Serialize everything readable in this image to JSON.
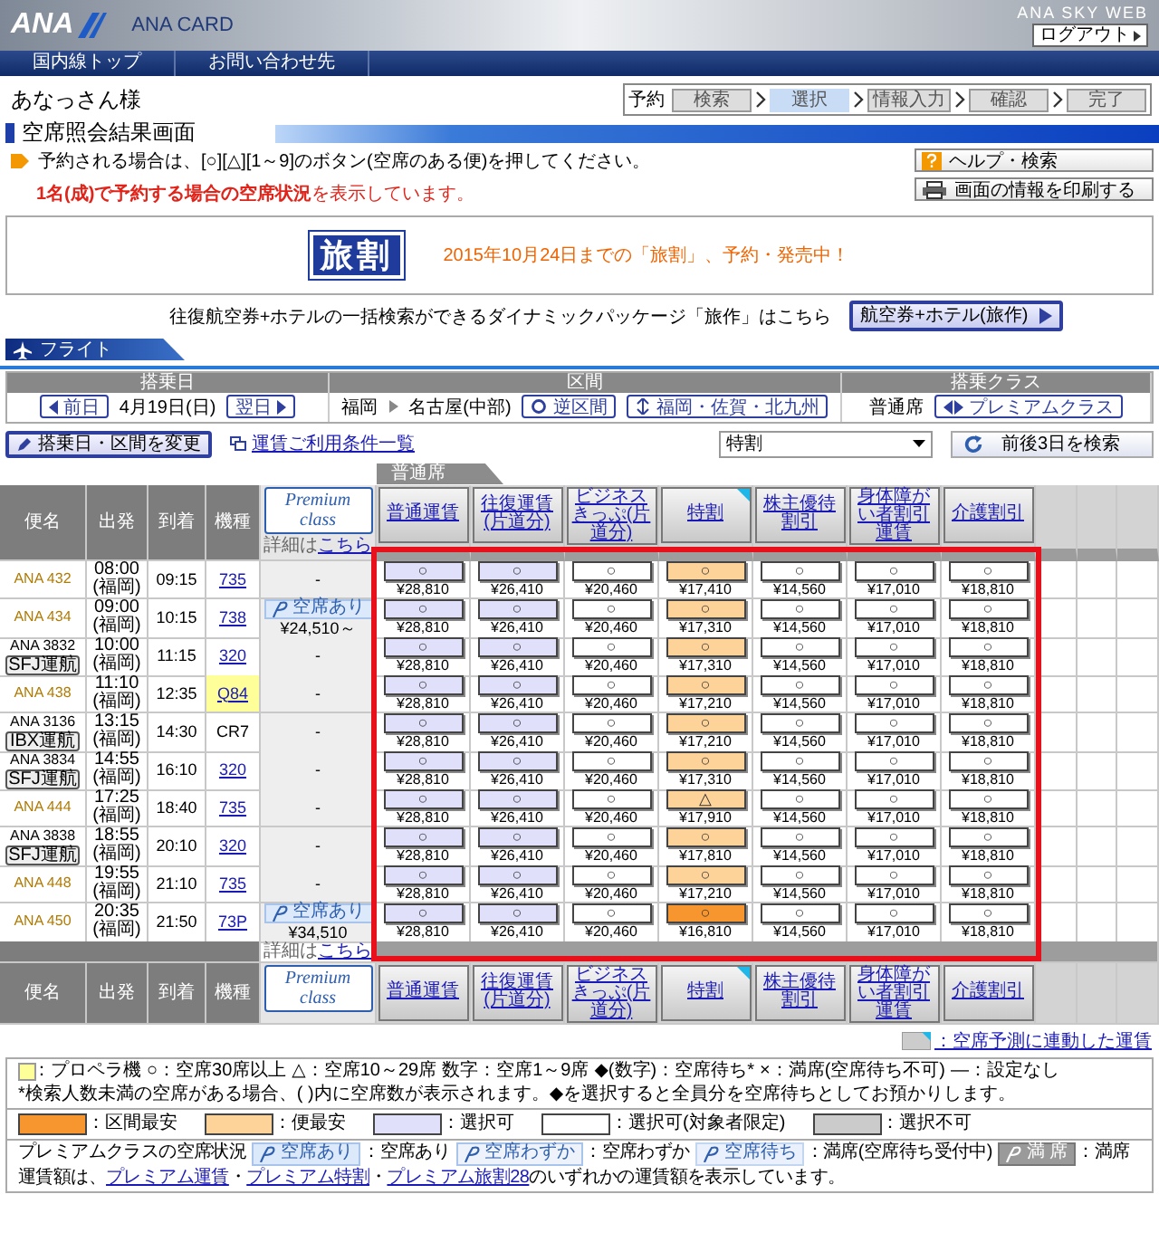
{
  "header": {
    "logo": "ANA",
    "brand": "ANA CARD",
    "site": "ANA SKY WEB",
    "logout": "ログアウト"
  },
  "nav": [
    {
      "label": "国内線トップ"
    },
    {
      "label": "お問い合わせ先"
    }
  ],
  "user": "あなっさん様",
  "steps": {
    "label": "予約",
    "items": [
      {
        "label": "検索",
        "selected": false
      },
      {
        "label": "選択",
        "selected": true
      },
      {
        "label": "情報入力",
        "selected": false
      },
      {
        "label": "確認",
        "selected": false
      },
      {
        "label": "完了",
        "selected": false
      }
    ]
  },
  "page_title": "空席照会結果画面",
  "instruction": "予約される場合は、[○][△][1～9]のボタン(空席のある便)を押してください。",
  "notice": "**1名(成)で予約する場合の空席状況**を表示しています。",
  "help_button": "ヘルプ・検索",
  "print_button": "画面の情報を印刷する",
  "banner": {
    "logo": "旅割",
    "text": "2015年10月24日までの「旅割」、予約・発売中！"
  },
  "package": {
    "text": "往復航空券+ホテルの一括検索ができるダイナミックパッケージ「旅作」はこちら",
    "button": "航空券+ホテル(旅作)"
  },
  "flight_tab": "フライト",
  "search": {
    "date_header": "搭乗日",
    "route_header": "区間",
    "class_header": "搭乗クラス",
    "prev": "前日",
    "date": "4月19日(日)",
    "next": "翌日",
    "from": "福岡",
    "to": "名古屋(中部)",
    "reverse": "逆区間",
    "area": "福岡・佐賀・北九州",
    "seat_class": "普通席",
    "premium": "プレミアムクラス"
  },
  "change_button": "搭乗日・区間を変更",
  "conditions_link": "運賃ご利用条件一覧",
  "fare_select": "特割",
  "search_3days": "前後3日を検索",
  "seat_tab": "普通席",
  "table": {
    "header": {
      "columns": [
        "便名",
        "出発",
        "到着",
        "機種"
      ],
      "premium_label": "Premium class",
      "detail": "詳細は",
      "detail_link": "こちら",
      "fare_types": [
        {
          "label": "普通運賃",
          "forecast": false
        },
        {
          "label": "往復運賃(片道分)",
          "forecast": false
        },
        {
          "label": "ビジネスきっぷ(片道分)",
          "forecast": false
        },
        {
          "label": "特割",
          "forecast": true
        },
        {
          "label": "株主優待割引",
          "forecast": false
        },
        {
          "label": "身体障がい者割引運賃",
          "forecast": false
        },
        {
          "label": "介護割引",
          "forecast": false
        }
      ]
    },
    "footer": {
      "columns": [
        "便名",
        "出発",
        "到着",
        "機種"
      ],
      "premium_label": "Premium class",
      "detail": "詳細は",
      "detail_link": "こちら",
      "fare_types": [
        {
          "label": "普通運賃",
          "forecast": false
        },
        {
          "label": "往復運賃(片道分)",
          "forecast": false
        },
        {
          "label": "ビジネスきっぷ(片道分)",
          "forecast": false
        },
        {
          "label": "特割",
          "forecast": true
        },
        {
          "label": "株主優待割引",
          "forecast": false
        },
        {
          "label": "身体障がい者割引運賃",
          "forecast": false
        },
        {
          "label": "介護割引",
          "forecast": false
        }
      ]
    }
  },
  "flights": [
    {
      "number": "ANA 432",
      "departure": "08:00",
      "departure_airport": "(福岡)",
      "arrival": "09:15",
      "aircraft": "735",
      "link": true,
      "propeller": false,
      "premium": {
        "kind": "none",
        "text": "-"
      },
      "fares": [
        {
          "mark": "○",
          "price": "¥28,810",
          "kind": "selectable"
        },
        {
          "mark": "○",
          "price": "¥26,410",
          "kind": "selectable"
        },
        {
          "mark": "○",
          "price": "¥20,460",
          "kind": "restricted"
        },
        {
          "mark": "○",
          "price": "¥17,410",
          "kind": "flight-cheapest"
        },
        {
          "mark": "○",
          "price": "¥14,560",
          "kind": "restricted"
        },
        {
          "mark": "○",
          "price": "¥17,010",
          "kind": "restricted"
        },
        {
          "mark": "○",
          "price": "¥18,810",
          "kind": "restricted"
        }
      ]
    },
    {
      "number": "ANA 434",
      "departure": "09:00",
      "departure_airport": "(福岡)",
      "arrival": "10:15",
      "aircraft": "738",
      "link": true,
      "propeller": false,
      "premium": {
        "kind": "available",
        "badge": "空席あり",
        "price": "¥24,510～"
      },
      "fares": [
        {
          "mark": "○",
          "price": "¥28,810",
          "kind": "selectable"
        },
        {
          "mark": "○",
          "price": "¥26,410",
          "kind": "selectable"
        },
        {
          "mark": "○",
          "price": "¥20,460",
          "kind": "restricted"
        },
        {
          "mark": "○",
          "price": "¥17,310",
          "kind": "flight-cheapest"
        },
        {
          "mark": "○",
          "price": "¥14,560",
          "kind": "restricted"
        },
        {
          "mark": "○",
          "price": "¥17,010",
          "kind": "restricted"
        },
        {
          "mark": "○",
          "price": "¥18,810",
          "kind": "restricted"
        }
      ]
    },
    {
      "number": "ANA 3832",
      "operator": "SFJ運航",
      "departure": "10:00",
      "departure_airport": "(福岡)",
      "arrival": "11:15",
      "aircraft": "320",
      "link": true,
      "propeller": false,
      "premium": {
        "kind": "none",
        "text": "-"
      },
      "fares": [
        {
          "mark": "○",
          "price": "¥28,810",
          "kind": "selectable"
        },
        {
          "mark": "○",
          "price": "¥26,410",
          "kind": "selectable"
        },
        {
          "mark": "○",
          "price": "¥20,460",
          "kind": "restricted"
        },
        {
          "mark": "○",
          "price": "¥17,310",
          "kind": "flight-cheapest"
        },
        {
          "mark": "○",
          "price": "¥14,560",
          "kind": "restricted"
        },
        {
          "mark": "○",
          "price": "¥17,010",
          "kind": "restricted"
        },
        {
          "mark": "○",
          "price": "¥18,810",
          "kind": "restricted"
        }
      ]
    },
    {
      "number": "ANA 438",
      "departure": "11:10",
      "departure_airport": "(福岡)",
      "arrival": "12:35",
      "aircraft": "Q84",
      "link": true,
      "propeller": true,
      "premium": {
        "kind": "none",
        "text": "-"
      },
      "fares": [
        {
          "mark": "○",
          "price": "¥28,810",
          "kind": "selectable"
        },
        {
          "mark": "○",
          "price": "¥26,410",
          "kind": "selectable"
        },
        {
          "mark": "○",
          "price": "¥20,460",
          "kind": "restricted"
        },
        {
          "mark": "○",
          "price": "¥17,210",
          "kind": "flight-cheapest"
        },
        {
          "mark": "○",
          "price": "¥14,560",
          "kind": "restricted"
        },
        {
          "mark": "○",
          "price": "¥17,010",
          "kind": "restricted"
        },
        {
          "mark": "○",
          "price": "¥18,810",
          "kind": "restricted"
        }
      ]
    },
    {
      "number": "ANA 3136",
      "operator": "IBX運航",
      "departure": "13:15",
      "departure_airport": "(福岡)",
      "arrival": "14:30",
      "aircraft": "CR7",
      "link": false,
      "propeller": false,
      "premium": {
        "kind": "none",
        "text": "-"
      },
      "fares": [
        {
          "mark": "○",
          "price": "¥28,810",
          "kind": "selectable"
        },
        {
          "mark": "○",
          "price": "¥26,410",
          "kind": "selectable"
        },
        {
          "mark": "○",
          "price": "¥20,460",
          "kind": "restricted"
        },
        {
          "mark": "○",
          "price": "¥17,210",
          "kind": "flight-cheapest"
        },
        {
          "mark": "○",
          "price": "¥14,560",
          "kind": "restricted"
        },
        {
          "mark": "○",
          "price": "¥17,010",
          "kind": "restricted"
        },
        {
          "mark": "○",
          "price": "¥18,810",
          "kind": "restricted"
        }
      ]
    },
    {
      "number": "ANA 3834",
      "operator": "SFJ運航",
      "departure": "14:55",
      "departure_airport": "(福岡)",
      "arrival": "16:10",
      "aircraft": "320",
      "link": true,
      "propeller": false,
      "premium": {
        "kind": "none",
        "text": "-"
      },
      "fares": [
        {
          "mark": "○",
          "price": "¥28,810",
          "kind": "selectable"
        },
        {
          "mark": "○",
          "price": "¥26,410",
          "kind": "selectable"
        },
        {
          "mark": "○",
          "price": "¥20,460",
          "kind": "restricted"
        },
        {
          "mark": "○",
          "price": "¥17,310",
          "kind": "flight-cheapest"
        },
        {
          "mark": "○",
          "price": "¥14,560",
          "kind": "restricted"
        },
        {
          "mark": "○",
          "price": "¥17,010",
          "kind": "restricted"
        },
        {
          "mark": "○",
          "price": "¥18,810",
          "kind": "restricted"
        }
      ]
    },
    {
      "number": "ANA 444",
      "departure": "17:25",
      "departure_airport": "(福岡)",
      "arrival": "18:40",
      "aircraft": "735",
      "link": true,
      "propeller": false,
      "premium": {
        "kind": "none",
        "text": "-"
      },
      "fares": [
        {
          "mark": "○",
          "price": "¥28,810",
          "kind": "selectable"
        },
        {
          "mark": "○",
          "price": "¥26,410",
          "kind": "selectable"
        },
        {
          "mark": "○",
          "price": "¥20,460",
          "kind": "restricted"
        },
        {
          "mark": "△",
          "price": "¥17,910",
          "kind": "flight-cheapest"
        },
        {
          "mark": "○",
          "price": "¥14,560",
          "kind": "restricted"
        },
        {
          "mark": "○",
          "price": "¥17,010",
          "kind": "restricted"
        },
        {
          "mark": "○",
          "price": "¥18,810",
          "kind": "restricted"
        }
      ]
    },
    {
      "number": "ANA 3838",
      "operator": "SFJ運航",
      "departure": "18:55",
      "departure_airport": "(福岡)",
      "arrival": "20:10",
      "aircraft": "320",
      "link": true,
      "propeller": false,
      "premium": {
        "kind": "none",
        "text": "-"
      },
      "fares": [
        {
          "mark": "○",
          "price": "¥28,810",
          "kind": "selectable"
        },
        {
          "mark": "○",
          "price": "¥26,410",
          "kind": "selectable"
        },
        {
          "mark": "○",
          "price": "¥20,460",
          "kind": "restricted"
        },
        {
          "mark": "○",
          "price": "¥17,810",
          "kind": "flight-cheapest"
        },
        {
          "mark": "○",
          "price": "¥14,560",
          "kind": "restricted"
        },
        {
          "mark": "○",
          "price": "¥17,010",
          "kind": "restricted"
        },
        {
          "mark": "○",
          "price": "¥18,810",
          "kind": "restricted"
        }
      ]
    },
    {
      "number": "ANA 448",
      "departure": "19:55",
      "departure_airport": "(福岡)",
      "arrival": "21:10",
      "aircraft": "735",
      "link": true,
      "propeller": false,
      "premium": {
        "kind": "none",
        "text": "-"
      },
      "fares": [
        {
          "mark": "○",
          "price": "¥28,810",
          "kind": "selectable"
        },
        {
          "mark": "○",
          "price": "¥26,410",
          "kind": "selectable"
        },
        {
          "mark": "○",
          "price": "¥20,460",
          "kind": "restricted"
        },
        {
          "mark": "○",
          "price": "¥17,210",
          "kind": "flight-cheapest"
        },
        {
          "mark": "○",
          "price": "¥14,560",
          "kind": "restricted"
        },
        {
          "mark": "○",
          "price": "¥17,010",
          "kind": "restricted"
        },
        {
          "mark": "○",
          "price": "¥18,810",
          "kind": "restricted"
        }
      ]
    },
    {
      "number": "ANA 450",
      "departure": "20:35",
      "departure_airport": "(福岡)",
      "arrival": "21:50",
      "aircraft": "73P",
      "link": true,
      "propeller": false,
      "premium": {
        "kind": "available",
        "badge": "空席あり",
        "price": "¥34,510"
      },
      "fares": [
        {
          "mark": "○",
          "price": "¥28,810",
          "kind": "selectable"
        },
        {
          "mark": "○",
          "price": "¥26,410",
          "kind": "selectable"
        },
        {
          "mark": "○",
          "price": "¥20,460",
          "kind": "restricted"
        },
        {
          "mark": "○",
          "price": "¥16,810",
          "kind": "route-cheapest"
        },
        {
          "mark": "○",
          "price": "¥14,560",
          "kind": "restricted"
        },
        {
          "mark": "○",
          "price": "¥17,010",
          "kind": "restricted"
        },
        {
          "mark": "○",
          "price": "¥18,810",
          "kind": "restricted"
        }
      ]
    }
  ],
  "forecast_link": "：空席予測に連動した運賃",
  "legend": {
    "propeller": "：プロペラ機",
    "symbols": [
      "○：空席30席以上",
      "△：空席10～29席",
      "数字：空席1～9席",
      "◆(数字)：空席待ち*",
      "×：満席(空席待ち不可)",
      "—：設定なし"
    ],
    "note": "*検索人数未満の空席がある場合、( )内に空席数が表示されます。◆を選択すると全員分を空席待ちとしてお預かりします。",
    "tiers": [
      {
        "kind": "route-cheapest",
        "label": "：区間最安"
      },
      {
        "kind": "flight-cheapest",
        "label": "：便最安"
      },
      {
        "kind": "selectable",
        "label": "：選択可"
      },
      {
        "kind": "restricted",
        "label": "：選択可(対象者限定)"
      },
      {
        "kind": "unavailable",
        "label": "：選択不可"
      }
    ],
    "premium_title": "プレミアムクラスの空席状況",
    "premium": [
      {
        "kind": "available",
        "badge": "空席あり",
        "label": "：空席あり"
      },
      {
        "kind": "few",
        "badge": "空席わずか",
        "label": "：空席わずか"
      },
      {
        "kind": "waitlist",
        "badge": "空席待ち",
        "label": "：満席(空席待ち受付中)"
      },
      {
        "kind": "full",
        "badge": "満 席",
        "label": "：満席"
      }
    ],
    "fare_note_prefix": "運賃額は、",
    "fare_link_separator": "・",
    "fare_links": [
      "プレミアム運賃",
      "プレミアム特割",
      "プレミアム旅割28"
    ],
    "fare_note_suffix": "のいずれかの運賃額を表示しています。"
  }
}
